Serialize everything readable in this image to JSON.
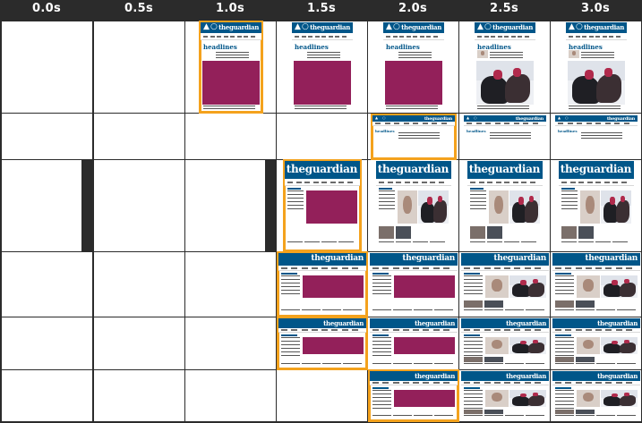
{
  "timeline": {
    "labels": [
      "0.0s",
      "0.5s",
      "1.0s",
      "1.5s",
      "2.0s",
      "2.5s",
      "3.0s"
    ]
  },
  "brand": {
    "logo_text": "theguardian",
    "section_heading": "headlines"
  },
  "colors": {
    "background": "#2b2b2b",
    "guardian_blue": "#005689",
    "promo_magenta": "#93205a",
    "changed_frame_highlight": "#f4a21d"
  },
  "icons": {
    "user": "user-icon",
    "search": "search-icon"
  },
  "rows": [
    {
      "name": "mobile-portrait",
      "states": [
        "blank",
        "blank",
        "promo",
        "promo",
        "promo",
        "photo",
        "photo"
      ],
      "changed": [
        2
      ]
    },
    {
      "name": "mobile-landscape",
      "states": [
        "blank",
        "blank",
        "blank",
        "blank",
        "text",
        "text",
        "text"
      ],
      "changed": [
        4
      ]
    },
    {
      "name": "tablet-portrait",
      "states": [
        "blank",
        "blank",
        "blank",
        "promo",
        "photo",
        "photo",
        "photo"
      ],
      "changed": [
        3
      ]
    },
    {
      "name": "tablet-landscape",
      "states": [
        "blank",
        "blank",
        "blank",
        "promo",
        "promo",
        "photo",
        "photo"
      ],
      "changed": [
        3
      ]
    },
    {
      "name": "desktop",
      "states": [
        "blank",
        "blank",
        "blank",
        "promo",
        "promo",
        "photo",
        "photo"
      ],
      "changed": [
        3
      ]
    },
    {
      "name": "wide-desktop",
      "states": [
        "blank",
        "blank",
        "blank",
        "blank",
        "promo",
        "photo",
        "photo"
      ],
      "changed": [
        4
      ]
    }
  ]
}
